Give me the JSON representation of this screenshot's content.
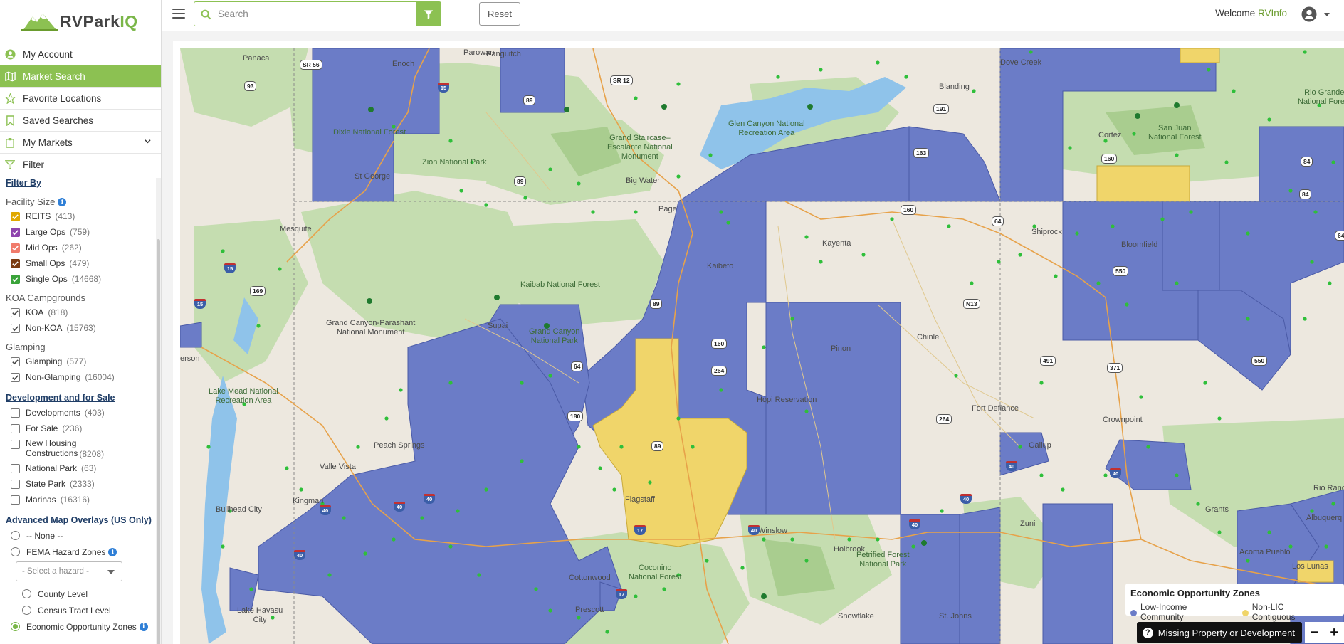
{
  "brand": {
    "name_left": "RVPark",
    "name_right": "IQ"
  },
  "nav": [
    {
      "label": "My Account",
      "icon": "user-circle-icon",
      "active": false
    },
    {
      "label": "Market Search",
      "icon": "map-icon",
      "active": true
    },
    {
      "label": "Favorite Locations",
      "icon": "star-icon",
      "active": false
    },
    {
      "label": "Saved Searches",
      "icon": "bookmark-icon",
      "active": false
    },
    {
      "label": "My Markets",
      "icon": "clipboard-icon",
      "active": false
    },
    {
      "label": "Filter",
      "icon": "filter-icon",
      "active": false
    }
  ],
  "filters": {
    "filter_by": "Filter By",
    "facility_size": {
      "title": "Facility Size",
      "items": [
        {
          "label": "REITS",
          "count": "(413)",
          "checked": true,
          "color": "#e0a800"
        },
        {
          "label": "Large Ops",
          "count": "(759)",
          "checked": true,
          "color": "#8e44ad"
        },
        {
          "label": "Mid Ops",
          "count": "(262)",
          "checked": true,
          "color": "#f07b6b"
        },
        {
          "label": "Small Ops",
          "count": "(479)",
          "checked": true,
          "color": "#7a3b10"
        },
        {
          "label": "Single Ops",
          "count": "(14668)",
          "checked": true,
          "color": "#3aa33a"
        }
      ]
    },
    "koa": {
      "title": "KOA Campgrounds",
      "items": [
        {
          "label": "KOA",
          "count": "(818)",
          "checked": true
        },
        {
          "label": "Non-KOA",
          "count": "(15763)",
          "checked": true
        }
      ]
    },
    "glamping": {
      "title": "Glamping",
      "items": [
        {
          "label": "Glamping",
          "count": "(577)",
          "checked": true
        },
        {
          "label": "Non-Glamping",
          "count": "(16004)",
          "checked": true
        }
      ]
    },
    "development": {
      "title": "Development and for Sale",
      "items": [
        {
          "label": "Developments",
          "count": "(403)"
        },
        {
          "label": "For Sale",
          "count": "(236)"
        },
        {
          "label": "New Housing Constructions",
          "line1": "New Housing",
          "line2": "Constructions",
          "count": "(8208)"
        },
        {
          "label": "National Park",
          "count": "(63)"
        },
        {
          "label": "State Park",
          "count": "(2333)"
        },
        {
          "label": "Marinas",
          "count": "(16316)"
        }
      ]
    },
    "overlays": {
      "title": "Advanced Map Overlays (US Only)",
      "none": "-- None --",
      "fema": "FEMA Hazard Zones",
      "hazard_placeholder": "- Select a hazard -",
      "county": "County Level",
      "census": "Census Tract Level",
      "eoz": "Economic Opportunity Zones"
    }
  },
  "topbar": {
    "search_placeholder": "Search",
    "reset": "Reset",
    "welcome": "Welcome",
    "username": "RVInfo"
  },
  "map": {
    "legend": {
      "title": "Economic Opportunity Zones",
      "items": [
        {
          "label": "Low-Income Community",
          "color": "#6b7cc7"
        },
        {
          "label": "Non-LIC Contiguous",
          "color": "#f0d56a"
        }
      ]
    },
    "missing_button": "Missing Property or Development",
    "zoom_out": "−",
    "zoom_in": "+",
    "labels": {
      "panaca": "Panaca",
      "enoch": "Enoch",
      "paragonah": "Parowan",
      "panguitch": "Panguitch",
      "dove_creek": "Dove Creek",
      "blanding": "Blanding",
      "dixie": "Dixie National Forest",
      "zion": "Zion National Park",
      "st_george": "St George",
      "grand_staircase": "Grand Staircase–\nEscalante National\nMonument",
      "glen_canyon": "Glen Canyon National\nRecreation Area",
      "big_water": "Big Water",
      "page": "Page",
      "mesquite": "Mesquite",
      "cortez": "Cortez",
      "san_juan": "San Juan\nNational Forest",
      "rio_grande": "Rio Grande\nNational Forest",
      "kaibeto": "Kaibeto",
      "kayenta": "Kayenta",
      "shiprock": "Shiprock",
      "bloomfield": "Bloomfield",
      "kaibab": "Kaibab National Forest",
      "grand_canyon_parashant": "Grand Canyon-Parashant\nNational Monument",
      "supai": "Supai",
      "grand_canyon": "Grand Canyon\nNational Park",
      "chinle": "Chinle",
      "pinon": "Pinon",
      "hopi": "Hopi Reservation",
      "lake_mead": "Lake Mead National\nRecreation Area",
      "henderson": "erson",
      "fort_defiance": "Fort Defiance",
      "crownpoint": "Crownpoint",
      "peach_springs": "Peach Springs",
      "valle_vista": "Valle Vista",
      "gallup": "Gallup",
      "kingman": "Kingman",
      "flagstaff": "Flagstaff",
      "bullhead": "Bullhead City",
      "winslow": "Winslow",
      "holbrook": "Holbrook",
      "petrified": "Petrified Forest\nNational Park",
      "zuni": "Zuni",
      "grants": "Grants",
      "rio_rancho": "Rio Ranc",
      "acoma": "Acoma Pueblo",
      "albuquerque": "Albuquerq",
      "los_lunas": "Los Lunas",
      "cottonwood": "Cottonwood",
      "coconino": "Coconino\nNational Forest",
      "prescott": "Prescott",
      "lake_havasu": "Lake Havasu\nCity",
      "snowflake": "Snowflake",
      "st_johns": "St. Johns"
    },
    "shields": {
      "sr56": "SR 56",
      "sr12": "SR 12",
      "us93": "93",
      "i15a": "15",
      "us89a": "89",
      "us89b": "89",
      "us89c": "89",
      "us191": "191",
      "us163": "163",
      "us160a": "160",
      "us160b": "160",
      "us64a": "64",
      "us64b": "64",
      "us84a": "84",
      "us84b": "84",
      "i15b": "15",
      "i15c": "15",
      "sr169": "169",
      "us89d": "89",
      "us160c": "160",
      "us264a": "264",
      "n13": "N13",
      "us550a": "550",
      "us550b": "550",
      "us491": "491",
      "us371": "371",
      "us264b": "264",
      "us180": "180",
      "us64c": "64",
      "us89e": "89",
      "i40a": "40",
      "i40b": "40",
      "i40c": "40",
      "i40d": "40",
      "i40e": "40",
      "i40f": "40",
      "i40g": "40",
      "i40h": "40",
      "i40i": "40",
      "i17a": "17",
      "i17b": "17"
    }
  }
}
